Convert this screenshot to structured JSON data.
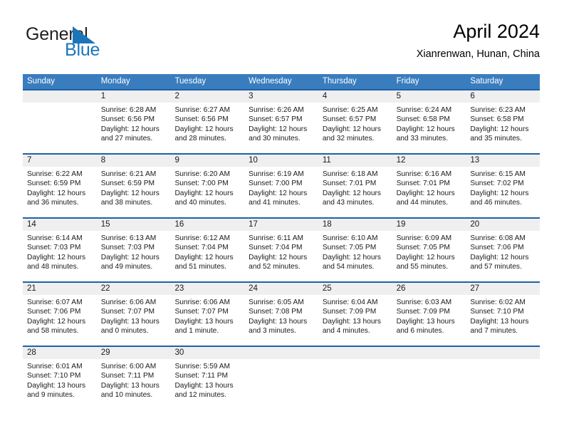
{
  "brand": {
    "word_one": "General",
    "word_two": "Blue",
    "flag_icon": "triangle-flag-icon",
    "color_dark": "#231f20",
    "color_blue": "#1a75bb"
  },
  "header": {
    "title": "April 2024",
    "subtitle": "Xianrenwan, Hunan, China"
  },
  "theme": {
    "header_bg": "#3a7dbf",
    "row_rule": "#1c62a8",
    "daynum_band": "#efefef",
    "text": "#1a1a1a"
  },
  "weekday_headers": [
    "Sunday",
    "Monday",
    "Tuesday",
    "Wednesday",
    "Thursday",
    "Friday",
    "Saturday"
  ],
  "weeks": [
    [
      {
        "day": "",
        "sunrise": "",
        "sunset": "",
        "daylight_1": "",
        "daylight_2": ""
      },
      {
        "day": "1",
        "sunrise": "Sunrise: 6:28 AM",
        "sunset": "Sunset: 6:56 PM",
        "daylight_1": "Daylight: 12 hours",
        "daylight_2": "and 27 minutes."
      },
      {
        "day": "2",
        "sunrise": "Sunrise: 6:27 AM",
        "sunset": "Sunset: 6:56 PM",
        "daylight_1": "Daylight: 12 hours",
        "daylight_2": "and 28 minutes."
      },
      {
        "day": "3",
        "sunrise": "Sunrise: 6:26 AM",
        "sunset": "Sunset: 6:57 PM",
        "daylight_1": "Daylight: 12 hours",
        "daylight_2": "and 30 minutes."
      },
      {
        "day": "4",
        "sunrise": "Sunrise: 6:25 AM",
        "sunset": "Sunset: 6:57 PM",
        "daylight_1": "Daylight: 12 hours",
        "daylight_2": "and 32 minutes."
      },
      {
        "day": "5",
        "sunrise": "Sunrise: 6:24 AM",
        "sunset": "Sunset: 6:58 PM",
        "daylight_1": "Daylight: 12 hours",
        "daylight_2": "and 33 minutes."
      },
      {
        "day": "6",
        "sunrise": "Sunrise: 6:23 AM",
        "sunset": "Sunset: 6:58 PM",
        "daylight_1": "Daylight: 12 hours",
        "daylight_2": "and 35 minutes."
      }
    ],
    [
      {
        "day": "7",
        "sunrise": "Sunrise: 6:22 AM",
        "sunset": "Sunset: 6:59 PM",
        "daylight_1": "Daylight: 12 hours",
        "daylight_2": "and 36 minutes."
      },
      {
        "day": "8",
        "sunrise": "Sunrise: 6:21 AM",
        "sunset": "Sunset: 6:59 PM",
        "daylight_1": "Daylight: 12 hours",
        "daylight_2": "and 38 minutes."
      },
      {
        "day": "9",
        "sunrise": "Sunrise: 6:20 AM",
        "sunset": "Sunset: 7:00 PM",
        "daylight_1": "Daylight: 12 hours",
        "daylight_2": "and 40 minutes."
      },
      {
        "day": "10",
        "sunrise": "Sunrise: 6:19 AM",
        "sunset": "Sunset: 7:00 PM",
        "daylight_1": "Daylight: 12 hours",
        "daylight_2": "and 41 minutes."
      },
      {
        "day": "11",
        "sunrise": "Sunrise: 6:18 AM",
        "sunset": "Sunset: 7:01 PM",
        "daylight_1": "Daylight: 12 hours",
        "daylight_2": "and 43 minutes."
      },
      {
        "day": "12",
        "sunrise": "Sunrise: 6:16 AM",
        "sunset": "Sunset: 7:01 PM",
        "daylight_1": "Daylight: 12 hours",
        "daylight_2": "and 44 minutes."
      },
      {
        "day": "13",
        "sunrise": "Sunrise: 6:15 AM",
        "sunset": "Sunset: 7:02 PM",
        "daylight_1": "Daylight: 12 hours",
        "daylight_2": "and 46 minutes."
      }
    ],
    [
      {
        "day": "14",
        "sunrise": "Sunrise: 6:14 AM",
        "sunset": "Sunset: 7:03 PM",
        "daylight_1": "Daylight: 12 hours",
        "daylight_2": "and 48 minutes."
      },
      {
        "day": "15",
        "sunrise": "Sunrise: 6:13 AM",
        "sunset": "Sunset: 7:03 PM",
        "daylight_1": "Daylight: 12 hours",
        "daylight_2": "and 49 minutes."
      },
      {
        "day": "16",
        "sunrise": "Sunrise: 6:12 AM",
        "sunset": "Sunset: 7:04 PM",
        "daylight_1": "Daylight: 12 hours",
        "daylight_2": "and 51 minutes."
      },
      {
        "day": "17",
        "sunrise": "Sunrise: 6:11 AM",
        "sunset": "Sunset: 7:04 PM",
        "daylight_1": "Daylight: 12 hours",
        "daylight_2": "and 52 minutes."
      },
      {
        "day": "18",
        "sunrise": "Sunrise: 6:10 AM",
        "sunset": "Sunset: 7:05 PM",
        "daylight_1": "Daylight: 12 hours",
        "daylight_2": "and 54 minutes."
      },
      {
        "day": "19",
        "sunrise": "Sunrise: 6:09 AM",
        "sunset": "Sunset: 7:05 PM",
        "daylight_1": "Daylight: 12 hours",
        "daylight_2": "and 55 minutes."
      },
      {
        "day": "20",
        "sunrise": "Sunrise: 6:08 AM",
        "sunset": "Sunset: 7:06 PM",
        "daylight_1": "Daylight: 12 hours",
        "daylight_2": "and 57 minutes."
      }
    ],
    [
      {
        "day": "21",
        "sunrise": "Sunrise: 6:07 AM",
        "sunset": "Sunset: 7:06 PM",
        "daylight_1": "Daylight: 12 hours",
        "daylight_2": "and 58 minutes."
      },
      {
        "day": "22",
        "sunrise": "Sunrise: 6:06 AM",
        "sunset": "Sunset: 7:07 PM",
        "daylight_1": "Daylight: 13 hours",
        "daylight_2": "and 0 minutes."
      },
      {
        "day": "23",
        "sunrise": "Sunrise: 6:06 AM",
        "sunset": "Sunset: 7:07 PM",
        "daylight_1": "Daylight: 13 hours",
        "daylight_2": "and 1 minute."
      },
      {
        "day": "24",
        "sunrise": "Sunrise: 6:05 AM",
        "sunset": "Sunset: 7:08 PM",
        "daylight_1": "Daylight: 13 hours",
        "daylight_2": "and 3 minutes."
      },
      {
        "day": "25",
        "sunrise": "Sunrise: 6:04 AM",
        "sunset": "Sunset: 7:09 PM",
        "daylight_1": "Daylight: 13 hours",
        "daylight_2": "and 4 minutes."
      },
      {
        "day": "26",
        "sunrise": "Sunrise: 6:03 AM",
        "sunset": "Sunset: 7:09 PM",
        "daylight_1": "Daylight: 13 hours",
        "daylight_2": "and 6 minutes."
      },
      {
        "day": "27",
        "sunrise": "Sunrise: 6:02 AM",
        "sunset": "Sunset: 7:10 PM",
        "daylight_1": "Daylight: 13 hours",
        "daylight_2": "and 7 minutes."
      }
    ],
    [
      {
        "day": "28",
        "sunrise": "Sunrise: 6:01 AM",
        "sunset": "Sunset: 7:10 PM",
        "daylight_1": "Daylight: 13 hours",
        "daylight_2": "and 9 minutes."
      },
      {
        "day": "29",
        "sunrise": "Sunrise: 6:00 AM",
        "sunset": "Sunset: 7:11 PM",
        "daylight_1": "Daylight: 13 hours",
        "daylight_2": "and 10 minutes."
      },
      {
        "day": "30",
        "sunrise": "Sunrise: 5:59 AM",
        "sunset": "Sunset: 7:11 PM",
        "daylight_1": "Daylight: 13 hours",
        "daylight_2": "and 12 minutes."
      },
      {
        "day": "",
        "sunrise": "",
        "sunset": "",
        "daylight_1": "",
        "daylight_2": ""
      },
      {
        "day": "",
        "sunrise": "",
        "sunset": "",
        "daylight_1": "",
        "daylight_2": ""
      },
      {
        "day": "",
        "sunrise": "",
        "sunset": "",
        "daylight_1": "",
        "daylight_2": ""
      },
      {
        "day": "",
        "sunrise": "",
        "sunset": "",
        "daylight_1": "",
        "daylight_2": ""
      }
    ]
  ]
}
